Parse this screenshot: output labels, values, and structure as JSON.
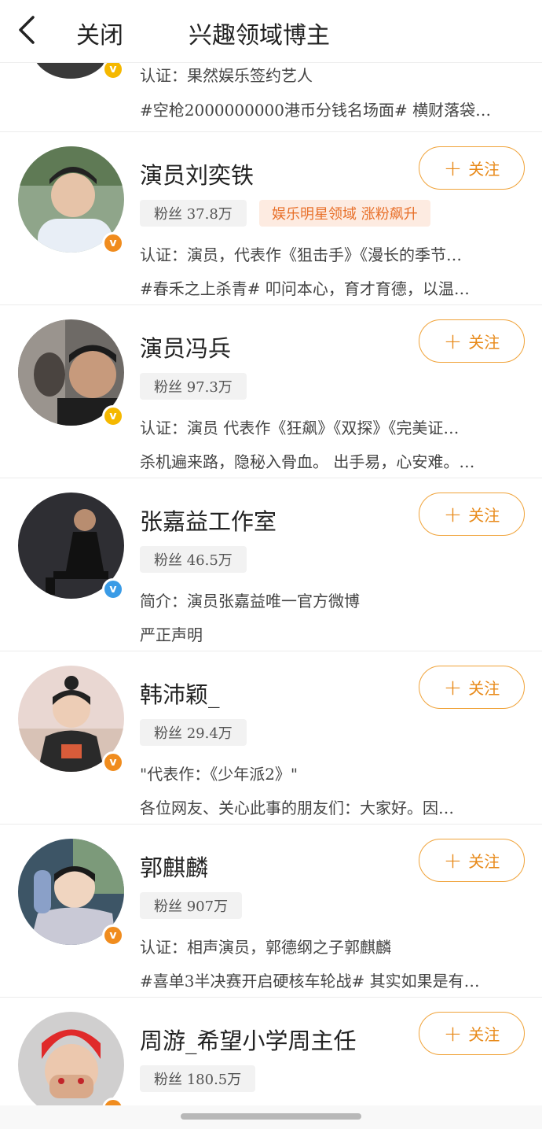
{
  "header": {
    "close_label": "关闭",
    "title": "兴趣领域博主"
  },
  "partial_item": {
    "line1": "认证：果然娱乐签约艺人",
    "line2": "#空枪2000000000港币分钱名场面# 横财落袋…",
    "badge_color": "#f5b800"
  },
  "follow_label": "关注",
  "items": [
    {
      "name": "演员刘奕铁",
      "fans": "粉丝 37.8万",
      "tag": "娱乐明星领域 涨粉飙升",
      "line1": "认证：演员，代表作《狙击手》《漫长的季节…",
      "line2": "#春禾之上杀青# 叩问本心，育才育德，以温…",
      "badge": "orange"
    },
    {
      "name": "演员冯兵",
      "fans": "粉丝 97.3万",
      "line1": "认证：演员 代表作《狂飙》《双探》《完美证…",
      "line2": "杀机遍来路，隐秘入骨血。 出手易，心安难。…",
      "badge": "yellow"
    },
    {
      "name": "张嘉益工作室",
      "fans": "粉丝 46.5万",
      "line1": "简介：演员张嘉益唯一官方微博",
      "line2": "严正声明",
      "badge": "blue"
    },
    {
      "name": "韩沛颖_",
      "fans": "粉丝 29.4万",
      "line1": "\"代表作：《少年派2》\"",
      "line2": "各位网友、关心此事的朋友们：大家好。因…",
      "badge": "orange"
    },
    {
      "name": "郭麒麟",
      "fans": "粉丝 907万",
      "line1": "认证：相声演员，郭德纲之子郭麒麟",
      "line2": "#喜单3半决赛开启硬核车轮战# 其实如果是有…",
      "badge": "orange"
    },
    {
      "name": "周游_希望小学周主任",
      "fans": "粉丝 180.5万",
      "badge": "orange"
    }
  ]
}
